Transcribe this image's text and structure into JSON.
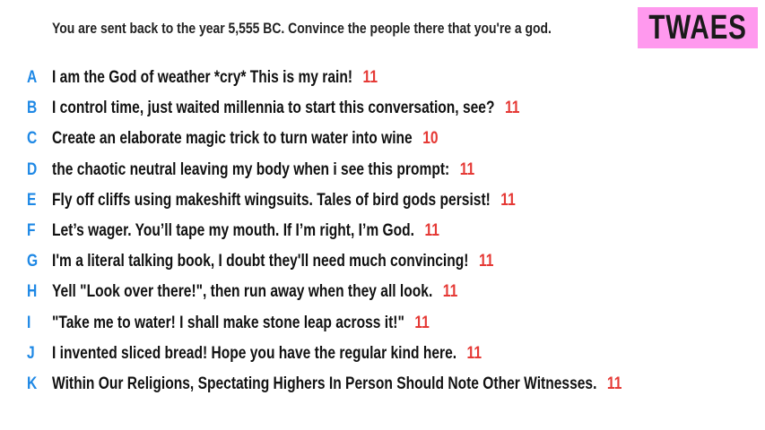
{
  "prompt": "You are sent back to the year 5,555 BC. Convince the people there that you're a god.",
  "badge": {
    "label": "TWAES",
    "color": "#ff99ee"
  },
  "colors": {
    "letter": "#1e88e5",
    "score": "#e53935"
  },
  "entries": [
    {
      "letter": "A",
      "text": "I am the God of weather *cry* This is my rain!",
      "score": "11"
    },
    {
      "letter": "B",
      "text": "I control time, just waited millennia to start this conversation, see?",
      "score": "11"
    },
    {
      "letter": "C",
      "text": "Create an elaborate magic trick to turn water into wine",
      "score": "10"
    },
    {
      "letter": "D",
      "text": "the chaotic neutral leaving my body when i see this prompt:",
      "score": "11"
    },
    {
      "letter": "E",
      "text": "Fly off cliffs using makeshift wingsuits. Tales of bird gods persist!",
      "score": "11"
    },
    {
      "letter": "F",
      "text": "Let’s wager. You’ll tape my mouth. If I’m right, I’m God.",
      "score": "11"
    },
    {
      "letter": "G",
      "text": "I'm a literal talking book, I doubt they'll need much convincing!",
      "score": "11"
    },
    {
      "letter": "H",
      "text": "Yell \"Look over there!\", then run away when they all look.",
      "score": "11"
    },
    {
      "letter": "I",
      "text": "\"Take me to water! I shall make stone leap across it!\"",
      "score": "11"
    },
    {
      "letter": "J",
      "text": "I invented sliced bread! Hope you have the regular kind here.",
      "score": "11"
    },
    {
      "letter": "K",
      "text": "Within Our Religions, Spectating Highers In Person Should Note Other Witnesses.",
      "score": "11"
    }
  ]
}
